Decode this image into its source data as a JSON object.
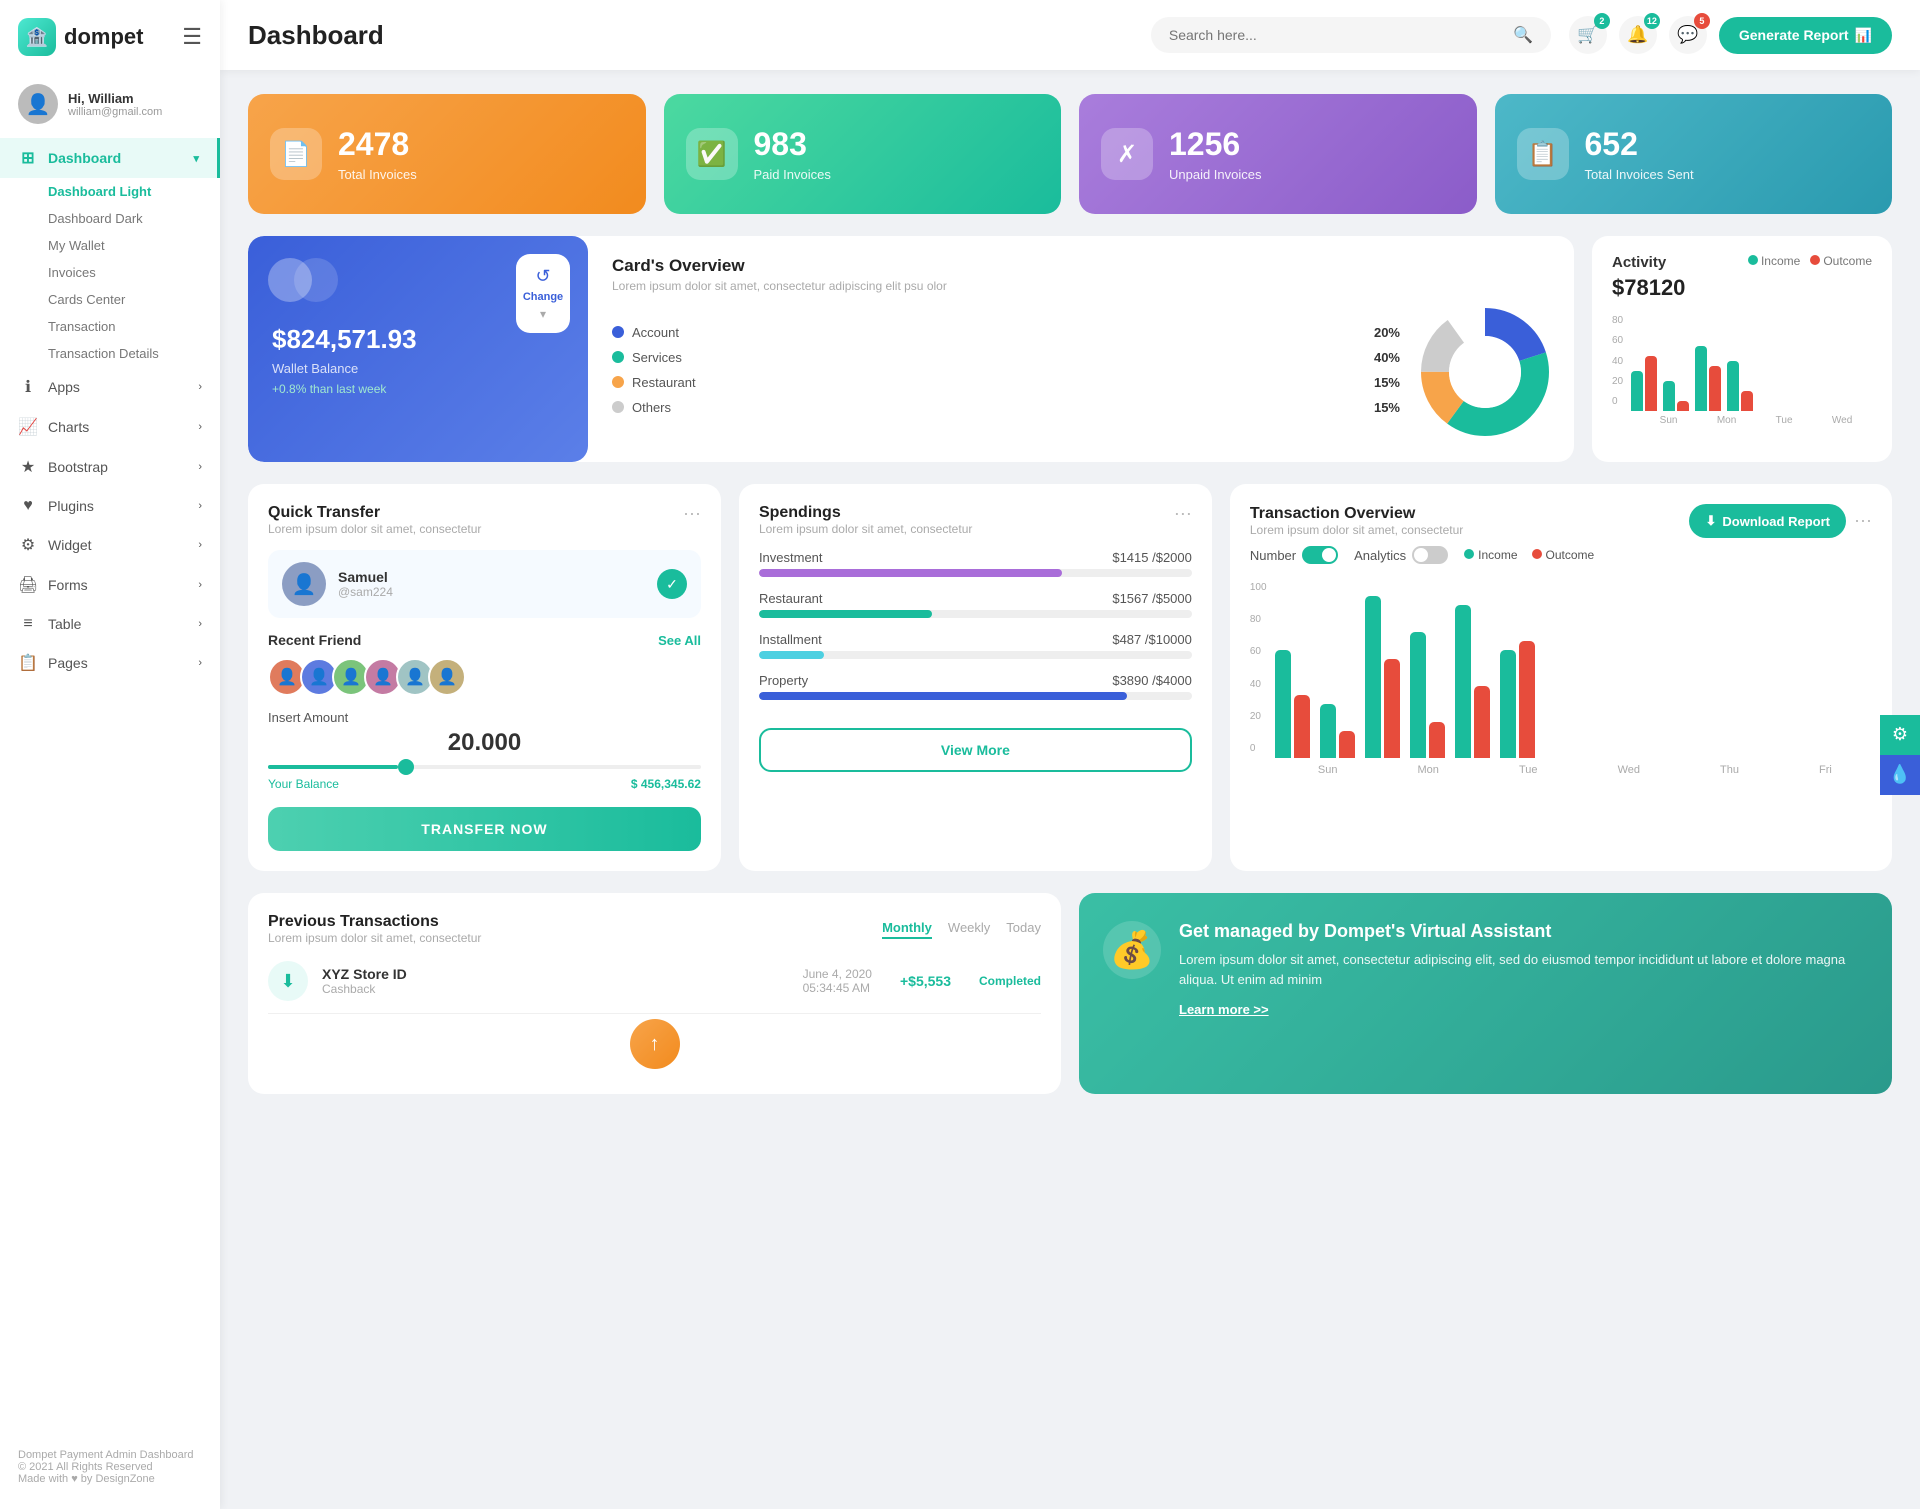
{
  "sidebar": {
    "logo": "dompet",
    "user": {
      "name": "Hi, William",
      "email": "william@gmail.com"
    },
    "nav": [
      {
        "id": "dashboard",
        "label": "Dashboard",
        "icon": "⊞",
        "active": true,
        "subitems": [
          {
            "label": "Dashboard Light",
            "active": true
          },
          {
            "label": "Dashboard Dark",
            "active": false
          },
          {
            "label": "My Wallet",
            "active": false
          },
          {
            "label": "Invoices",
            "active": false
          },
          {
            "label": "Cards Center",
            "active": false
          },
          {
            "label": "Transaction",
            "active": false
          },
          {
            "label": "Transaction Details",
            "active": false
          }
        ]
      },
      {
        "id": "apps",
        "label": "Apps",
        "icon": "ℹ",
        "active": false
      },
      {
        "id": "charts",
        "label": "Charts",
        "icon": "📈",
        "active": false
      },
      {
        "id": "bootstrap",
        "label": "Bootstrap",
        "icon": "★",
        "active": false
      },
      {
        "id": "plugins",
        "label": "Plugins",
        "icon": "♥",
        "active": false
      },
      {
        "id": "widget",
        "label": "Widget",
        "icon": "⚙",
        "active": false
      },
      {
        "id": "forms",
        "label": "Forms",
        "icon": "🖨",
        "active": false
      },
      {
        "id": "table",
        "label": "Table",
        "icon": "≡",
        "active": false
      },
      {
        "id": "pages",
        "label": "Pages",
        "icon": "📋",
        "active": false
      }
    ],
    "footer": {
      "brand": "Dompet Payment Admin Dashboard",
      "copy": "© 2021 All Rights Reserved",
      "made_by": "Made with ♥ by DesignZone"
    }
  },
  "header": {
    "title": "Dashboard",
    "search_placeholder": "Search here...",
    "generate_btn": "Generate Report",
    "badges": {
      "cart": "2",
      "bell": "12",
      "chat": "5"
    }
  },
  "stats": [
    {
      "label": "Total Invoices",
      "value": "2478",
      "color": "orange",
      "icon": "📄"
    },
    {
      "label": "Paid Invoices",
      "value": "983",
      "color": "green",
      "icon": "✅"
    },
    {
      "label": "Unpaid Invoices",
      "value": "1256",
      "color": "purple",
      "icon": "✗"
    },
    {
      "label": "Total Invoices Sent",
      "value": "652",
      "color": "teal",
      "icon": "📋"
    }
  ],
  "card_overview": {
    "wallet_amount": "$824,571.93",
    "wallet_label": "Wallet Balance",
    "wallet_growth": "+0.8% than last week",
    "title": "Card's Overview",
    "subtitle": "Lorem ipsum dolor sit amet, consectetur adipiscing elit psu olor",
    "legend": [
      {
        "label": "Account",
        "pct": "20%",
        "color": "#3a5fd9"
      },
      {
        "label": "Services",
        "pct": "40%",
        "color": "#1abc9c"
      },
      {
        "label": "Restaurant",
        "pct": "15%",
        "color": "#f7a44a"
      },
      {
        "label": "Others",
        "pct": "15%",
        "color": "#ccc"
      }
    ]
  },
  "activity": {
    "title": "Activity",
    "amount": "$78120",
    "legend": {
      "income": "Income",
      "outcome": "Outcome"
    },
    "bars": {
      "labels": [
        "Sun",
        "Mon",
        "Tue",
        "Wed"
      ],
      "income": [
        40,
        30,
        65,
        50
      ],
      "outcome": [
        55,
        10,
        45,
        20
      ]
    },
    "y_labels": [
      "0",
      "20",
      "40",
      "60",
      "80"
    ]
  },
  "quick_transfer": {
    "title": "Quick Transfer",
    "subtitle": "Lorem ipsum dolor sit amet, consectetur",
    "user": {
      "name": "Samuel",
      "handle": "@sam224",
      "avatar_color": "#8b9dc3"
    },
    "recent_label": "Recent Friend",
    "see_all": "See All",
    "friends_colors": [
      "#e07b5d",
      "#5d7be0",
      "#7bc47b",
      "#c47ba3",
      "#a0c4c4",
      "#c4b07b"
    ],
    "amount_label": "Insert Amount",
    "amount_value": "20.000",
    "balance_label": "Your Balance",
    "balance_value": "$ 456,345.62",
    "transfer_btn": "TRANSFER NOW"
  },
  "spendings": {
    "title": "Spendings",
    "subtitle": "Lorem ipsum dolor sit amet, consectetur",
    "items": [
      {
        "label": "Investment",
        "spent": "$1415",
        "total": "$2000",
        "pct": 70,
        "color": "#a96dd9"
      },
      {
        "label": "Restaurant",
        "spent": "$1567",
        "total": "$5000",
        "pct": 40,
        "color": "#1abc9c"
      },
      {
        "label": "Installment",
        "spent": "$487",
        "total": "$10000",
        "pct": 15,
        "color": "#4dd0e1"
      },
      {
        "label": "Property",
        "spent": "$3890",
        "total": "$4000",
        "pct": 85,
        "color": "#3a5fd9"
      }
    ],
    "view_more_btn": "View More"
  },
  "tx_overview": {
    "title": "Transaction Overview",
    "subtitle": "Lorem ipsum dolor sit amet, consectetur",
    "download_btn": "Download Report",
    "toggle_number": "Number",
    "toggle_analytics": "Analytics",
    "legend": {
      "income": "Income",
      "outcome": "Outcome"
    },
    "bars": {
      "labels": [
        "Sun",
        "Mon",
        "Tue",
        "Wed",
        "Thu",
        "Fri"
      ],
      "income": [
        60,
        30,
        90,
        70,
        85,
        60
      ],
      "outcome": [
        35,
        15,
        55,
        20,
        40,
        65
      ]
    },
    "y_labels": [
      "0",
      "20",
      "40",
      "60",
      "80",
      "100"
    ]
  },
  "prev_tx": {
    "title": "Previous Transactions",
    "subtitle": "Lorem ipsum dolor sit amet, consectetur",
    "tabs": [
      "Monthly",
      "Weekly",
      "Today"
    ],
    "active_tab": "Monthly",
    "transactions": [
      {
        "name": "XYZ Store ID",
        "type": "Cashback",
        "date": "June 4, 2020",
        "time": "05:34:45 AM",
        "amount": "+$5,553",
        "status": "Completed",
        "icon": "⬇"
      }
    ]
  },
  "va_banner": {
    "title": "Get managed by Dompet's Virtual Assistant",
    "desc": "Lorem ipsum dolor sit amet, consectetur adipiscing elit, sed do eiusmod tempor incididunt ut labore et dolore magna aliqua. Ut enim ad minim",
    "link": "Learn more >>"
  }
}
